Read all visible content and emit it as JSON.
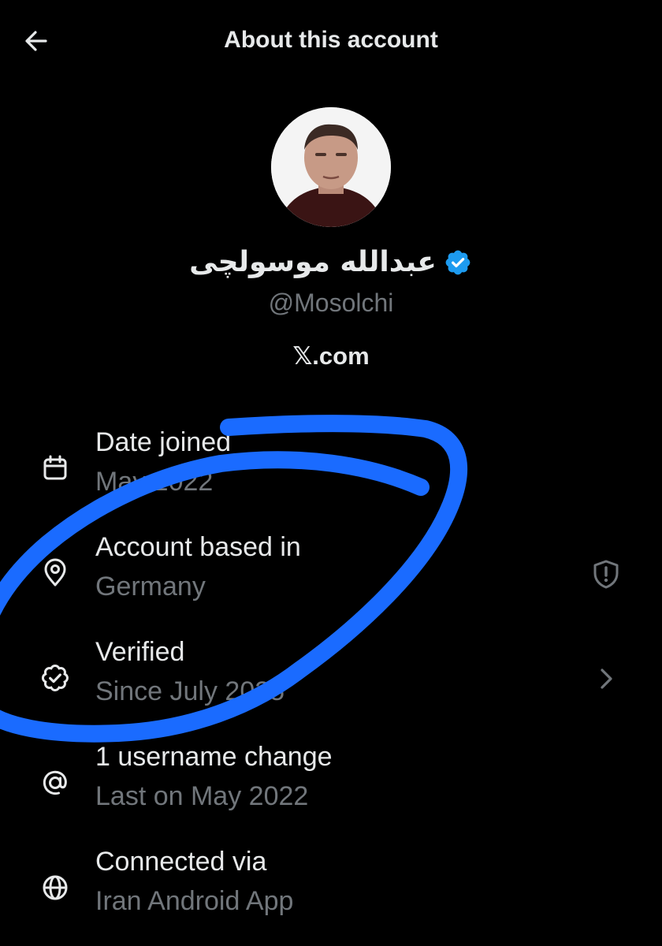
{
  "header": {
    "title": "About this account",
    "back_icon": "arrow-left-icon"
  },
  "profile": {
    "display_name": "عبدالله موسولچی",
    "verified": true,
    "handle": "@Mosolchi",
    "platform": "𝕏.com",
    "accent_color": "#1d9bf0"
  },
  "info": [
    {
      "icon": "calendar-icon",
      "title": "Date joined",
      "subtitle": "May 2022"
    },
    {
      "icon": "location-pin-icon",
      "title": "Account based in",
      "subtitle": "Germany",
      "action_icon": "shield-alert-icon"
    },
    {
      "icon": "verified-check-icon",
      "title": "Verified",
      "subtitle": "Since July 2025",
      "action_icon": "chevron-right-icon"
    },
    {
      "icon": "at-sign-icon",
      "title": "1 username change",
      "subtitle": "Last on May 2022"
    },
    {
      "icon": "globe-icon",
      "title": "Connected via",
      "subtitle": "Iran Android App"
    }
  ],
  "annotation": {
    "type": "hand-drawn-circle",
    "color": "#1a6bff"
  }
}
